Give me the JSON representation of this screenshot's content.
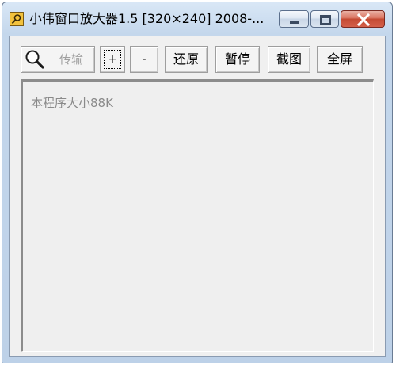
{
  "window": {
    "title": "小伟窗口放大器1.5 [320×240] 2008-..."
  },
  "titlebar": {
    "minimize_icon": "minimize-icon",
    "maximize_icon": "maximize-icon",
    "close_icon": "close-icon",
    "close_color": "#c44a33"
  },
  "toolbar": {
    "magnifier_icon": "magnifier-icon",
    "transfer_label": "传输",
    "zoom_in_label": "+",
    "zoom_out_label": "-",
    "restore_label": "还原",
    "pause_label": "暂停",
    "capture_label": "截图",
    "fullscreen_label": "全屏"
  },
  "display": {
    "size_note": "本程序大小88K"
  }
}
